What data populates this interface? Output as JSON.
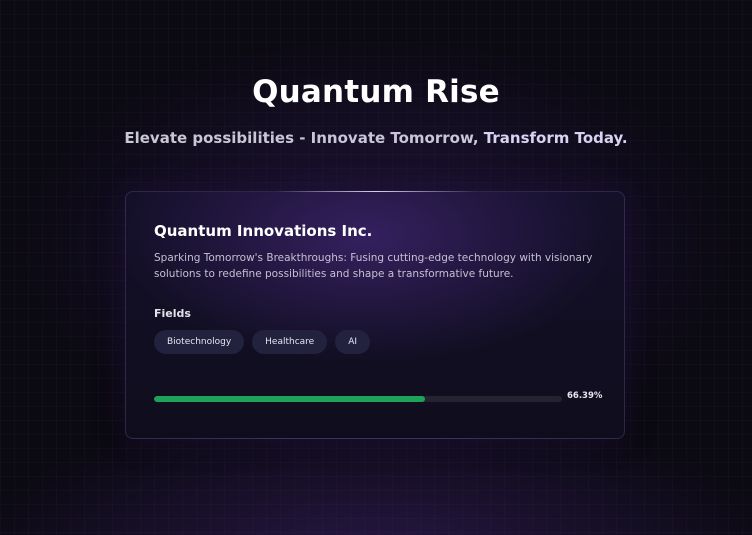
{
  "hero": {
    "title": "Quantum Rise",
    "subtitle_main": "Elevate possibilities - Innovate Tomorrow,",
    "subtitle_accent": "Transform Today."
  },
  "card": {
    "company_name": "Quantum Innovations Inc.",
    "description": "Sparking Tomorrow's Breakthroughs: Fusing cutting-edge technology with visionary solutions to redefine possibilities and shape a transformative future.",
    "fields_label": "Fields",
    "fields": [
      "Biotechnology",
      "Healthcare",
      "AI"
    ],
    "progress": {
      "value_percent": 66.39,
      "label": "66.39%"
    }
  },
  "colors": {
    "background": "#0b0912",
    "card_background": "#141029",
    "tag_background": "#22213e",
    "progress_fill": "#1ea25a",
    "progress_track": "#25232f"
  }
}
